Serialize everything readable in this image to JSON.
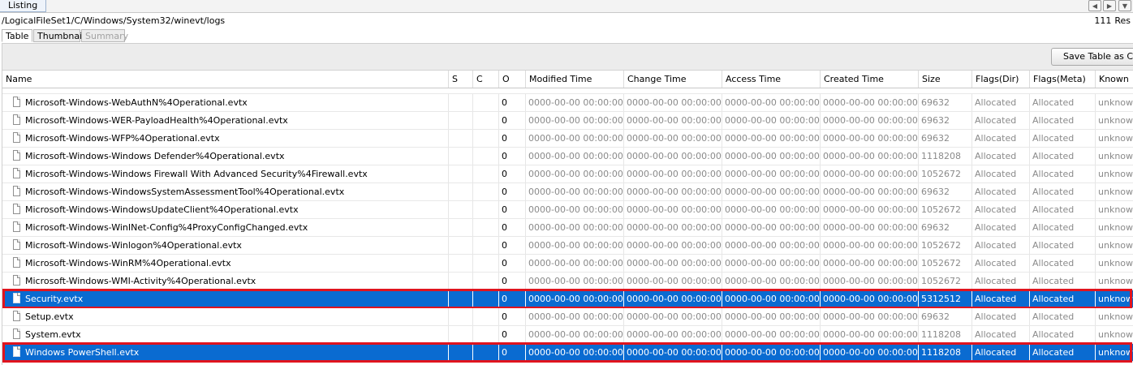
{
  "listing_tab": "Listing",
  "path": "/LogicalFileSet1/C/Windows/System32/winevt/logs",
  "results": {
    "count": "111",
    "label": "Res"
  },
  "subtabs": [
    {
      "label": "Table",
      "active": true
    },
    {
      "label": "Thumbnail",
      "active": false
    },
    {
      "label": "Summary",
      "active": false,
      "disabled": true
    }
  ],
  "save_csv_label": "Save Table as CSV",
  "columns": [
    "Name",
    "S",
    "C",
    "O",
    "Modified Time",
    "Change Time",
    "Access Time",
    "Created Time",
    "Size",
    "Flags(Dir)",
    "Flags(Meta)",
    "Known"
  ],
  "rows": [
    {
      "name": "Microsoft-Windows-WebAuthN%4Operational.evtx",
      "s": "",
      "c": "",
      "o": "0",
      "modified": "0000-00-00 00:00:00",
      "change": "0000-00-00 00:00:00",
      "access": "0000-00-00 00:00:00",
      "created": "0000-00-00 00:00:00",
      "size": "69632",
      "flags_dir": "Allocated",
      "flags_meta": "Allocated",
      "known": "unknown",
      "selected": false
    },
    {
      "name": "Microsoft-Windows-WER-PayloadHealth%4Operational.evtx",
      "s": "",
      "c": "",
      "o": "0",
      "modified": "0000-00-00 00:00:00",
      "change": "0000-00-00 00:00:00",
      "access": "0000-00-00 00:00:00",
      "created": "0000-00-00 00:00:00",
      "size": "69632",
      "flags_dir": "Allocated",
      "flags_meta": "Allocated",
      "known": "unknown",
      "selected": false
    },
    {
      "name": "Microsoft-Windows-WFP%4Operational.evtx",
      "s": "",
      "c": "",
      "o": "0",
      "modified": "0000-00-00 00:00:00",
      "change": "0000-00-00 00:00:00",
      "access": "0000-00-00 00:00:00",
      "created": "0000-00-00 00:00:00",
      "size": "69632",
      "flags_dir": "Allocated",
      "flags_meta": "Allocated",
      "known": "unknown",
      "selected": false
    },
    {
      "name": "Microsoft-Windows-Windows Defender%4Operational.evtx",
      "s": "",
      "c": "",
      "o": "0",
      "modified": "0000-00-00 00:00:00",
      "change": "0000-00-00 00:00:00",
      "access": "0000-00-00 00:00:00",
      "created": "0000-00-00 00:00:00",
      "size": "1118208",
      "flags_dir": "Allocated",
      "flags_meta": "Allocated",
      "known": "unknown",
      "selected": false
    },
    {
      "name": "Microsoft-Windows-Windows Firewall With Advanced Security%4Firewall.evtx",
      "s": "",
      "c": "",
      "o": "0",
      "modified": "0000-00-00 00:00:00",
      "change": "0000-00-00 00:00:00",
      "access": "0000-00-00 00:00:00",
      "created": "0000-00-00 00:00:00",
      "size": "1052672",
      "flags_dir": "Allocated",
      "flags_meta": "Allocated",
      "known": "unknown",
      "selected": false
    },
    {
      "name": "Microsoft-Windows-WindowsSystemAssessmentTool%4Operational.evtx",
      "s": "",
      "c": "",
      "o": "0",
      "modified": "0000-00-00 00:00:00",
      "change": "0000-00-00 00:00:00",
      "access": "0000-00-00 00:00:00",
      "created": "0000-00-00 00:00:00",
      "size": "69632",
      "flags_dir": "Allocated",
      "flags_meta": "Allocated",
      "known": "unknown",
      "selected": false
    },
    {
      "name": "Microsoft-Windows-WindowsUpdateClient%4Operational.evtx",
      "s": "",
      "c": "",
      "o": "0",
      "modified": "0000-00-00 00:00:00",
      "change": "0000-00-00 00:00:00",
      "access": "0000-00-00 00:00:00",
      "created": "0000-00-00 00:00:00",
      "size": "1052672",
      "flags_dir": "Allocated",
      "flags_meta": "Allocated",
      "known": "unknown",
      "selected": false
    },
    {
      "name": "Microsoft-Windows-WinINet-Config%4ProxyConfigChanged.evtx",
      "s": "",
      "c": "",
      "o": "0",
      "modified": "0000-00-00 00:00:00",
      "change": "0000-00-00 00:00:00",
      "access": "0000-00-00 00:00:00",
      "created": "0000-00-00 00:00:00",
      "size": "69632",
      "flags_dir": "Allocated",
      "flags_meta": "Allocated",
      "known": "unknown",
      "selected": false
    },
    {
      "name": "Microsoft-Windows-Winlogon%4Operational.evtx",
      "s": "",
      "c": "",
      "o": "0",
      "modified": "0000-00-00 00:00:00",
      "change": "0000-00-00 00:00:00",
      "access": "0000-00-00 00:00:00",
      "created": "0000-00-00 00:00:00",
      "size": "1052672",
      "flags_dir": "Allocated",
      "flags_meta": "Allocated",
      "known": "unknown",
      "selected": false
    },
    {
      "name": "Microsoft-Windows-WinRM%4Operational.evtx",
      "s": "",
      "c": "",
      "o": "0",
      "modified": "0000-00-00 00:00:00",
      "change": "0000-00-00 00:00:00",
      "access": "0000-00-00 00:00:00",
      "created": "0000-00-00 00:00:00",
      "size": "1052672",
      "flags_dir": "Allocated",
      "flags_meta": "Allocated",
      "known": "unknown",
      "selected": false
    },
    {
      "name": "Microsoft-Windows-WMI-Activity%4Operational.evtx",
      "s": "",
      "c": "",
      "o": "0",
      "modified": "0000-00-00 00:00:00",
      "change": "0000-00-00 00:00:00",
      "access": "0000-00-00 00:00:00",
      "created": "0000-00-00 00:00:00",
      "size": "1052672",
      "flags_dir": "Allocated",
      "flags_meta": "Allocated",
      "known": "unknown",
      "selected": false
    },
    {
      "name": "Security.evtx",
      "s": "",
      "c": "",
      "o": "0",
      "modified": "0000-00-00 00:00:00",
      "change": "0000-00-00 00:00:00",
      "access": "0000-00-00 00:00:00",
      "created": "0000-00-00 00:00:00",
      "size": "5312512",
      "flags_dir": "Allocated",
      "flags_meta": "Allocated",
      "known": "unknown",
      "selected": true
    },
    {
      "name": "Setup.evtx",
      "s": "",
      "c": "",
      "o": "0",
      "modified": "0000-00-00 00:00:00",
      "change": "0000-00-00 00:00:00",
      "access": "0000-00-00 00:00:00",
      "created": "0000-00-00 00:00:00",
      "size": "69632",
      "flags_dir": "Allocated",
      "flags_meta": "Allocated",
      "known": "unknown",
      "selected": false
    },
    {
      "name": "System.evtx",
      "s": "",
      "c": "",
      "o": "0",
      "modified": "0000-00-00 00:00:00",
      "change": "0000-00-00 00:00:00",
      "access": "0000-00-00 00:00:00",
      "created": "0000-00-00 00:00:00",
      "size": "1118208",
      "flags_dir": "Allocated",
      "flags_meta": "Allocated",
      "known": "unknown",
      "selected": false
    },
    {
      "name": "Windows PowerShell.evtx",
      "s": "",
      "c": "",
      "o": "0",
      "modified": "0000-00-00 00:00:00",
      "change": "0000-00-00 00:00:00",
      "access": "0000-00-00 00:00:00",
      "created": "0000-00-00 00:00:00",
      "size": "1118208",
      "flags_dir": "Allocated",
      "flags_meta": "Allocated",
      "known": "unknown",
      "selected": true
    }
  ],
  "colors": {
    "selection": "#0a6bd1",
    "highlight_border": "#e0141e",
    "secondary_text": "#8a8a8a"
  },
  "icons": {
    "row_icon": "file-icon",
    "nav": [
      "chevron-left-icon",
      "chevron-right-icon",
      "dropdown-icon"
    ]
  }
}
